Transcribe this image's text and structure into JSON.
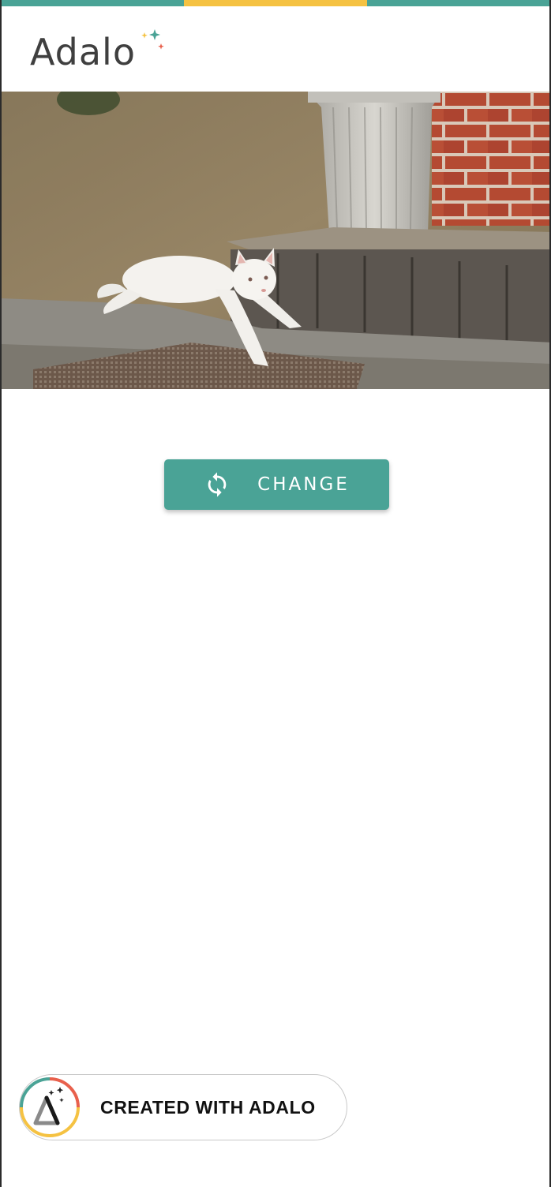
{
  "brand": {
    "name": "Adalo",
    "colors": {
      "teal": "#4aa396",
      "yellow": "#f5c242",
      "coral": "#e8604c",
      "logo_gray": "#3f3f3f"
    }
  },
  "top_strip": [
    "#4aa396",
    "#f5c242",
    "#4aa396"
  ],
  "hero": {
    "subject": "white kitten leaping down a step"
  },
  "action": {
    "label": "CHANGE",
    "icon": "refresh-icon",
    "color": "#4aa396"
  },
  "footer_badge": {
    "label": "CREATED WITH ADALO",
    "icon": "adalo-badge-icon"
  }
}
